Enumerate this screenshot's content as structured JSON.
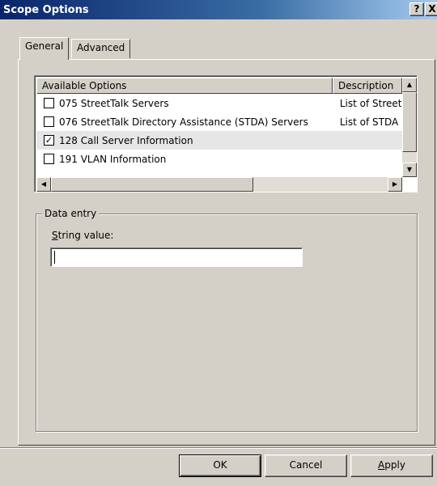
{
  "window": {
    "title": "Scope Options",
    "help_glyph": "?",
    "close_glyph": "X"
  },
  "tabs": [
    {
      "label": "General",
      "active": true
    },
    {
      "label": "Advanced",
      "active": false
    }
  ],
  "options_list": {
    "columns": [
      "Available Options",
      "Description"
    ],
    "rows": [
      {
        "checked": false,
        "name": "075 StreetTalk Servers",
        "description": "List of Street"
      },
      {
        "checked": false,
        "name": "076 StreetTalk Directory Assistance (STDA) Servers",
        "description": "List of STDA"
      },
      {
        "checked": true,
        "name": "128 Call Server Information",
        "description": ""
      },
      {
        "checked": false,
        "name": "191 VLAN Information",
        "description": ""
      }
    ]
  },
  "data_entry": {
    "group_label": "Data entry",
    "field_label_accel": "S",
    "field_label_rest": "tring value:",
    "value": ""
  },
  "buttons": {
    "ok": "OK",
    "cancel": "Cancel",
    "apply_accel": "A",
    "apply_rest": "pply"
  }
}
